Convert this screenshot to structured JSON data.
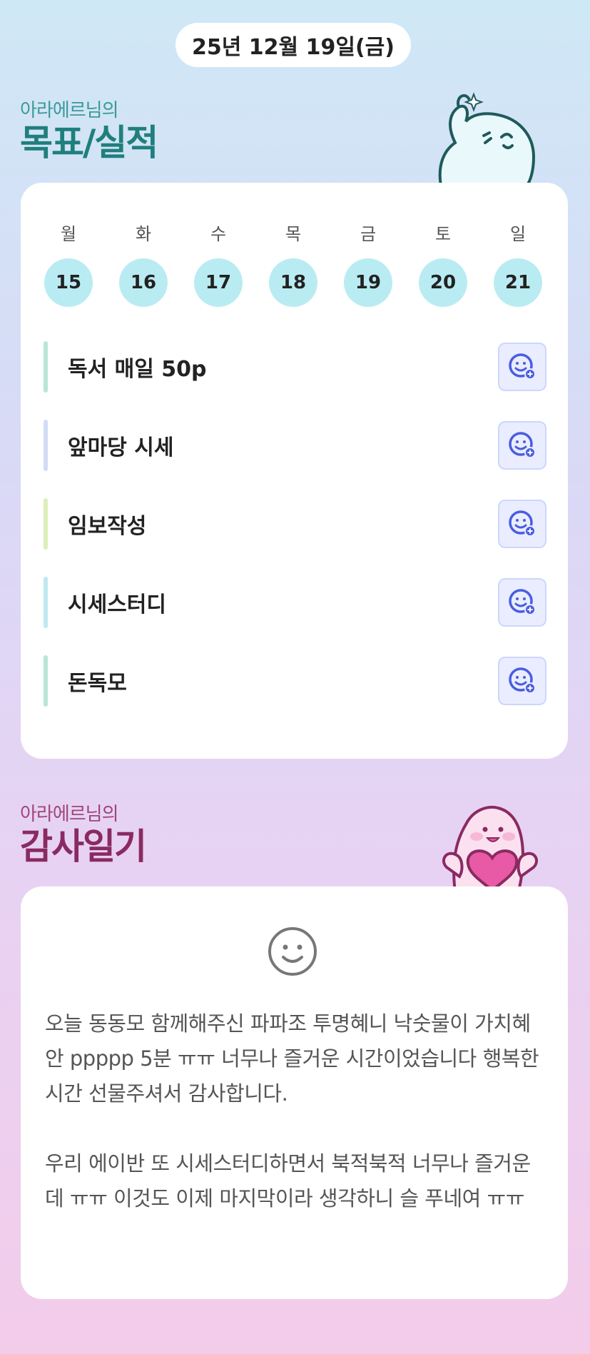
{
  "header": {
    "date": "25년 12월 19일(금)"
  },
  "goals_section": {
    "subtitle": "아라에르님의",
    "title": "목표/실적"
  },
  "week": {
    "days": [
      {
        "name": "월",
        "num": "15"
      },
      {
        "name": "화",
        "num": "16"
      },
      {
        "name": "수",
        "num": "17"
      },
      {
        "name": "목",
        "num": "18"
      },
      {
        "name": "금",
        "num": "19"
      },
      {
        "name": "토",
        "num": "20"
      },
      {
        "name": "일",
        "num": "21"
      }
    ]
  },
  "goals": [
    {
      "label": "독서 매일 50p",
      "color": "#b9e6d3"
    },
    {
      "label": "앞마당 시세",
      "color": "#d3dcf5"
    },
    {
      "label": "임보작성",
      "color": "#dcefb9"
    },
    {
      "label": "시세스터디",
      "color": "#bfe9f0"
    },
    {
      "label": "돈독모",
      "color": "#b9e6d3"
    }
  ],
  "gratitude_section": {
    "subtitle": "아라에르님의",
    "title": "감사일기"
  },
  "diary": {
    "paragraph1": "오늘 동동모 함께해주신  파파조 투명혜니 낙숫물이 가치혜안 ppppp 5분 ㅠㅠ 너무나 즐거운 시간이었습니다 행복한 시간 선물주셔서 감사합니다.",
    "paragraph2": "우리 에이반 또 시세스터디하면서 북적북적 너무나 즐거운데 ㅠㅠ 이것도 이제 마지막이라 생각하니 슬 푸네여 ㅠㅠ"
  },
  "colors": {
    "accent_teal": "#1f7f7c",
    "accent_plum": "#8a2a62",
    "day_circle": "#b9ecf2",
    "goal_button": "#e9edff",
    "goal_button_icon": "#4a5de0"
  },
  "icons": {
    "goal_button": "smile-add-icon",
    "diary_mood": "smile-face-icon"
  }
}
